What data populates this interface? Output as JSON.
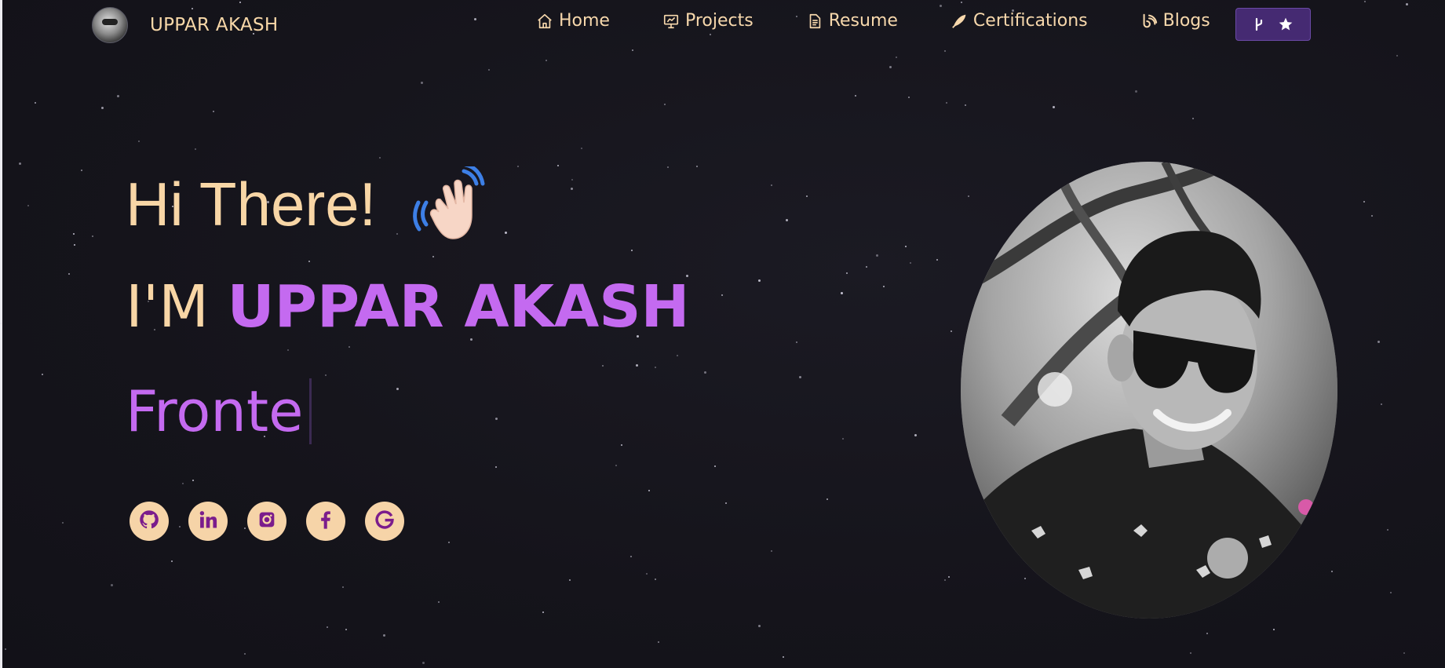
{
  "brand": {
    "name": "UPPAR AKASH"
  },
  "nav": {
    "items": [
      {
        "label": "Home",
        "icon": "home-icon"
      },
      {
        "label": "Projects",
        "icon": "presentation-icon"
      },
      {
        "label": "Resume",
        "icon": "document-icon"
      },
      {
        "label": "Certifications",
        "icon": "certificate-icon"
      },
      {
        "label": "Blogs",
        "icon": "blog-icon"
      }
    ],
    "github_button": {
      "icons": [
        "git-fork-icon",
        "star-icon"
      ]
    }
  },
  "hero": {
    "greeting": "Hi There!",
    "greeting_emoji": "waving-hand-icon",
    "intro_prefix": "I'M",
    "intro_name": "UPPAR AKASH",
    "typed_text": "Fronte"
  },
  "socials": [
    {
      "icon": "github-icon"
    },
    {
      "icon": "linkedin-icon"
    },
    {
      "icon": "instagram-icon"
    },
    {
      "icon": "facebook-icon"
    },
    {
      "icon": "google-icon"
    }
  ],
  "colors": {
    "background": "#16151d",
    "accent_peach": "#f8d6a6",
    "accent_purple": "#c46af0",
    "button_purple": "#452a72",
    "social_icon": "#7b1c8c"
  }
}
